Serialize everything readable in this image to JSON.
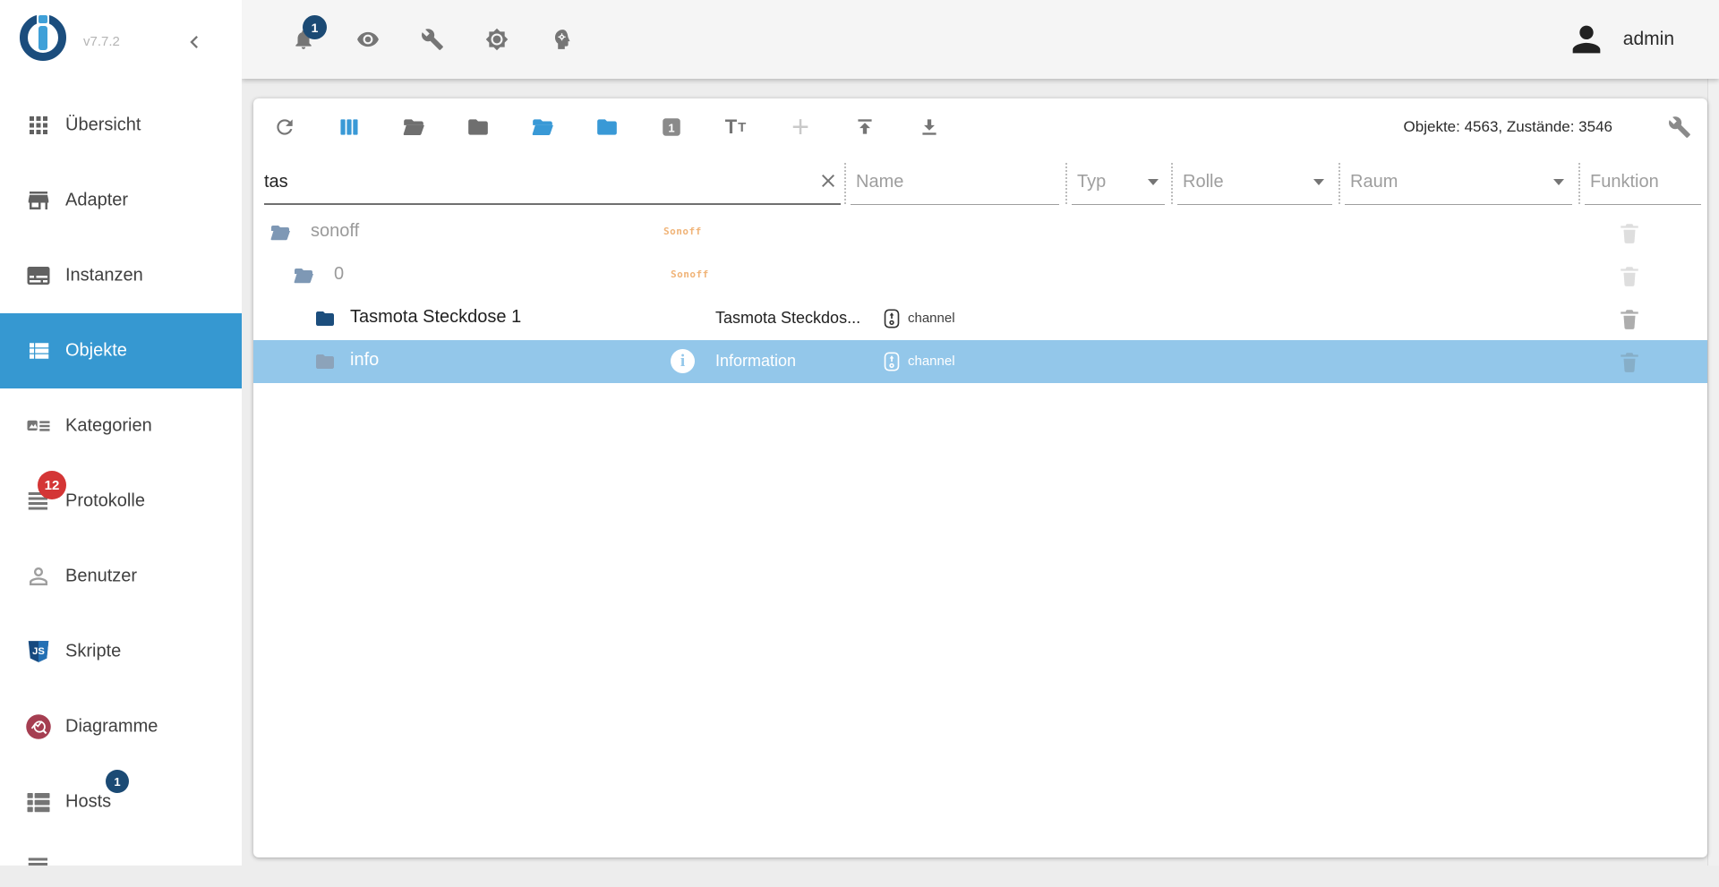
{
  "app": {
    "version": "v7.7.2",
    "user": "admin"
  },
  "header": {
    "bell_badge": "1",
    "icons": [
      "bell-icon",
      "eye-icon",
      "wrench-icon",
      "brightness-icon",
      "expert-mode-icon"
    ]
  },
  "sidebar": {
    "items": [
      {
        "label": "Übersicht"
      },
      {
        "label": "Adapter"
      },
      {
        "label": "Instanzen"
      },
      {
        "label": "Objekte",
        "selected": true
      },
      {
        "label": "Kategorien"
      },
      {
        "label": "Protokolle",
        "badge": "12"
      },
      {
        "label": "Benutzer"
      },
      {
        "label": "Skripte"
      },
      {
        "label": "Diagramme"
      },
      {
        "label": "Hosts",
        "badge": "1"
      }
    ]
  },
  "objects_panel": {
    "toolbar_icons": [
      "refresh-icon",
      "columns-icon",
      "folder-open-icon",
      "folder-icon",
      "folder-open-blue-icon",
      "folder-blue-icon",
      "one-square-icon",
      "text-size-icon",
      "plus-icon",
      "upload-icon",
      "download-icon",
      "wrench-icon"
    ],
    "plus_glyph": "+",
    "stats": "Objekte: 4563, Zustände: 3546",
    "filters": {
      "search_value": "tas",
      "name_placeholder": "Name",
      "typ_placeholder": "Typ",
      "rolle_placeholder": "Rolle",
      "raum_placeholder": "Raum",
      "funktion_placeholder": "Funktion"
    },
    "rows": [
      {
        "id": "sonoff",
        "logo": "Sonoff"
      },
      {
        "id": "0",
        "logo": "Sonoff"
      },
      {
        "id": "Tasmota Steckdose 1",
        "name": "Tasmota Steckdos...",
        "type": "channel"
      },
      {
        "id": "info",
        "icon_letter": "i",
        "name": "Information",
        "type": "channel",
        "selected": true
      }
    ]
  },
  "colors": {
    "accent_blue": "#3698d1",
    "selected_row": "#93c7ea",
    "badge_red": "#d43535",
    "badge_navy": "#1b4a74",
    "sonoff_orange": "#f0b377"
  }
}
